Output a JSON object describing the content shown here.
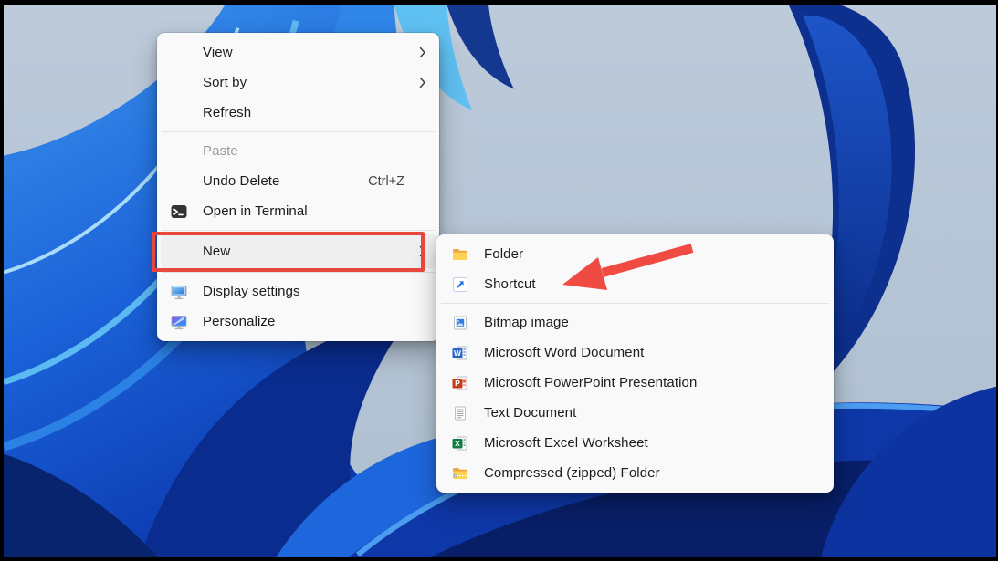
{
  "desktop": {
    "wallpaper_name": "windows-11-bloom",
    "colors": {
      "sky": "#b9c7d6",
      "bright_blue": "#2f86e8",
      "cyan_edge": "#5cbaf2",
      "deep_blue": "#0b2d85",
      "royal_blue": "#0e37a8"
    }
  },
  "context_menu": {
    "items": [
      {
        "label": "View",
        "has_submenu": true
      },
      {
        "label": "Sort by",
        "has_submenu": true
      },
      {
        "label": "Refresh"
      },
      {
        "type": "separator"
      },
      {
        "label": "Paste",
        "disabled": true
      },
      {
        "label": "Undo Delete",
        "shortcut": "Ctrl+Z"
      },
      {
        "label": "Open in Terminal",
        "icon": "terminal-icon"
      },
      {
        "type": "separator"
      },
      {
        "label": "New",
        "has_submenu": true,
        "highlighted": true
      },
      {
        "type": "separator"
      },
      {
        "label": "Display settings",
        "icon": "display-settings-icon"
      },
      {
        "label": "Personalize",
        "icon": "personalize-icon"
      }
    ]
  },
  "new_submenu": {
    "items": [
      {
        "label": "Folder",
        "icon": "folder-icon"
      },
      {
        "label": "Shortcut",
        "icon": "shortcut-icon"
      },
      {
        "type": "separator"
      },
      {
        "label": "Bitmap image",
        "icon": "bitmap-image-icon"
      },
      {
        "label": "Microsoft Word Document",
        "icon": "word-icon"
      },
      {
        "label": "Microsoft PowerPoint Presentation",
        "icon": "powerpoint-icon"
      },
      {
        "label": "Text Document",
        "icon": "text-document-icon"
      },
      {
        "label": "Microsoft Excel Worksheet",
        "icon": "excel-icon"
      },
      {
        "label": "Compressed (zipped) Folder",
        "icon": "zip-folder-icon"
      }
    ]
  },
  "annotations": {
    "highlighted_item": "New",
    "arrow_points_to": "Shortcut",
    "highlight_color": "#e8473c",
    "arrow_color": "#f04b42"
  }
}
